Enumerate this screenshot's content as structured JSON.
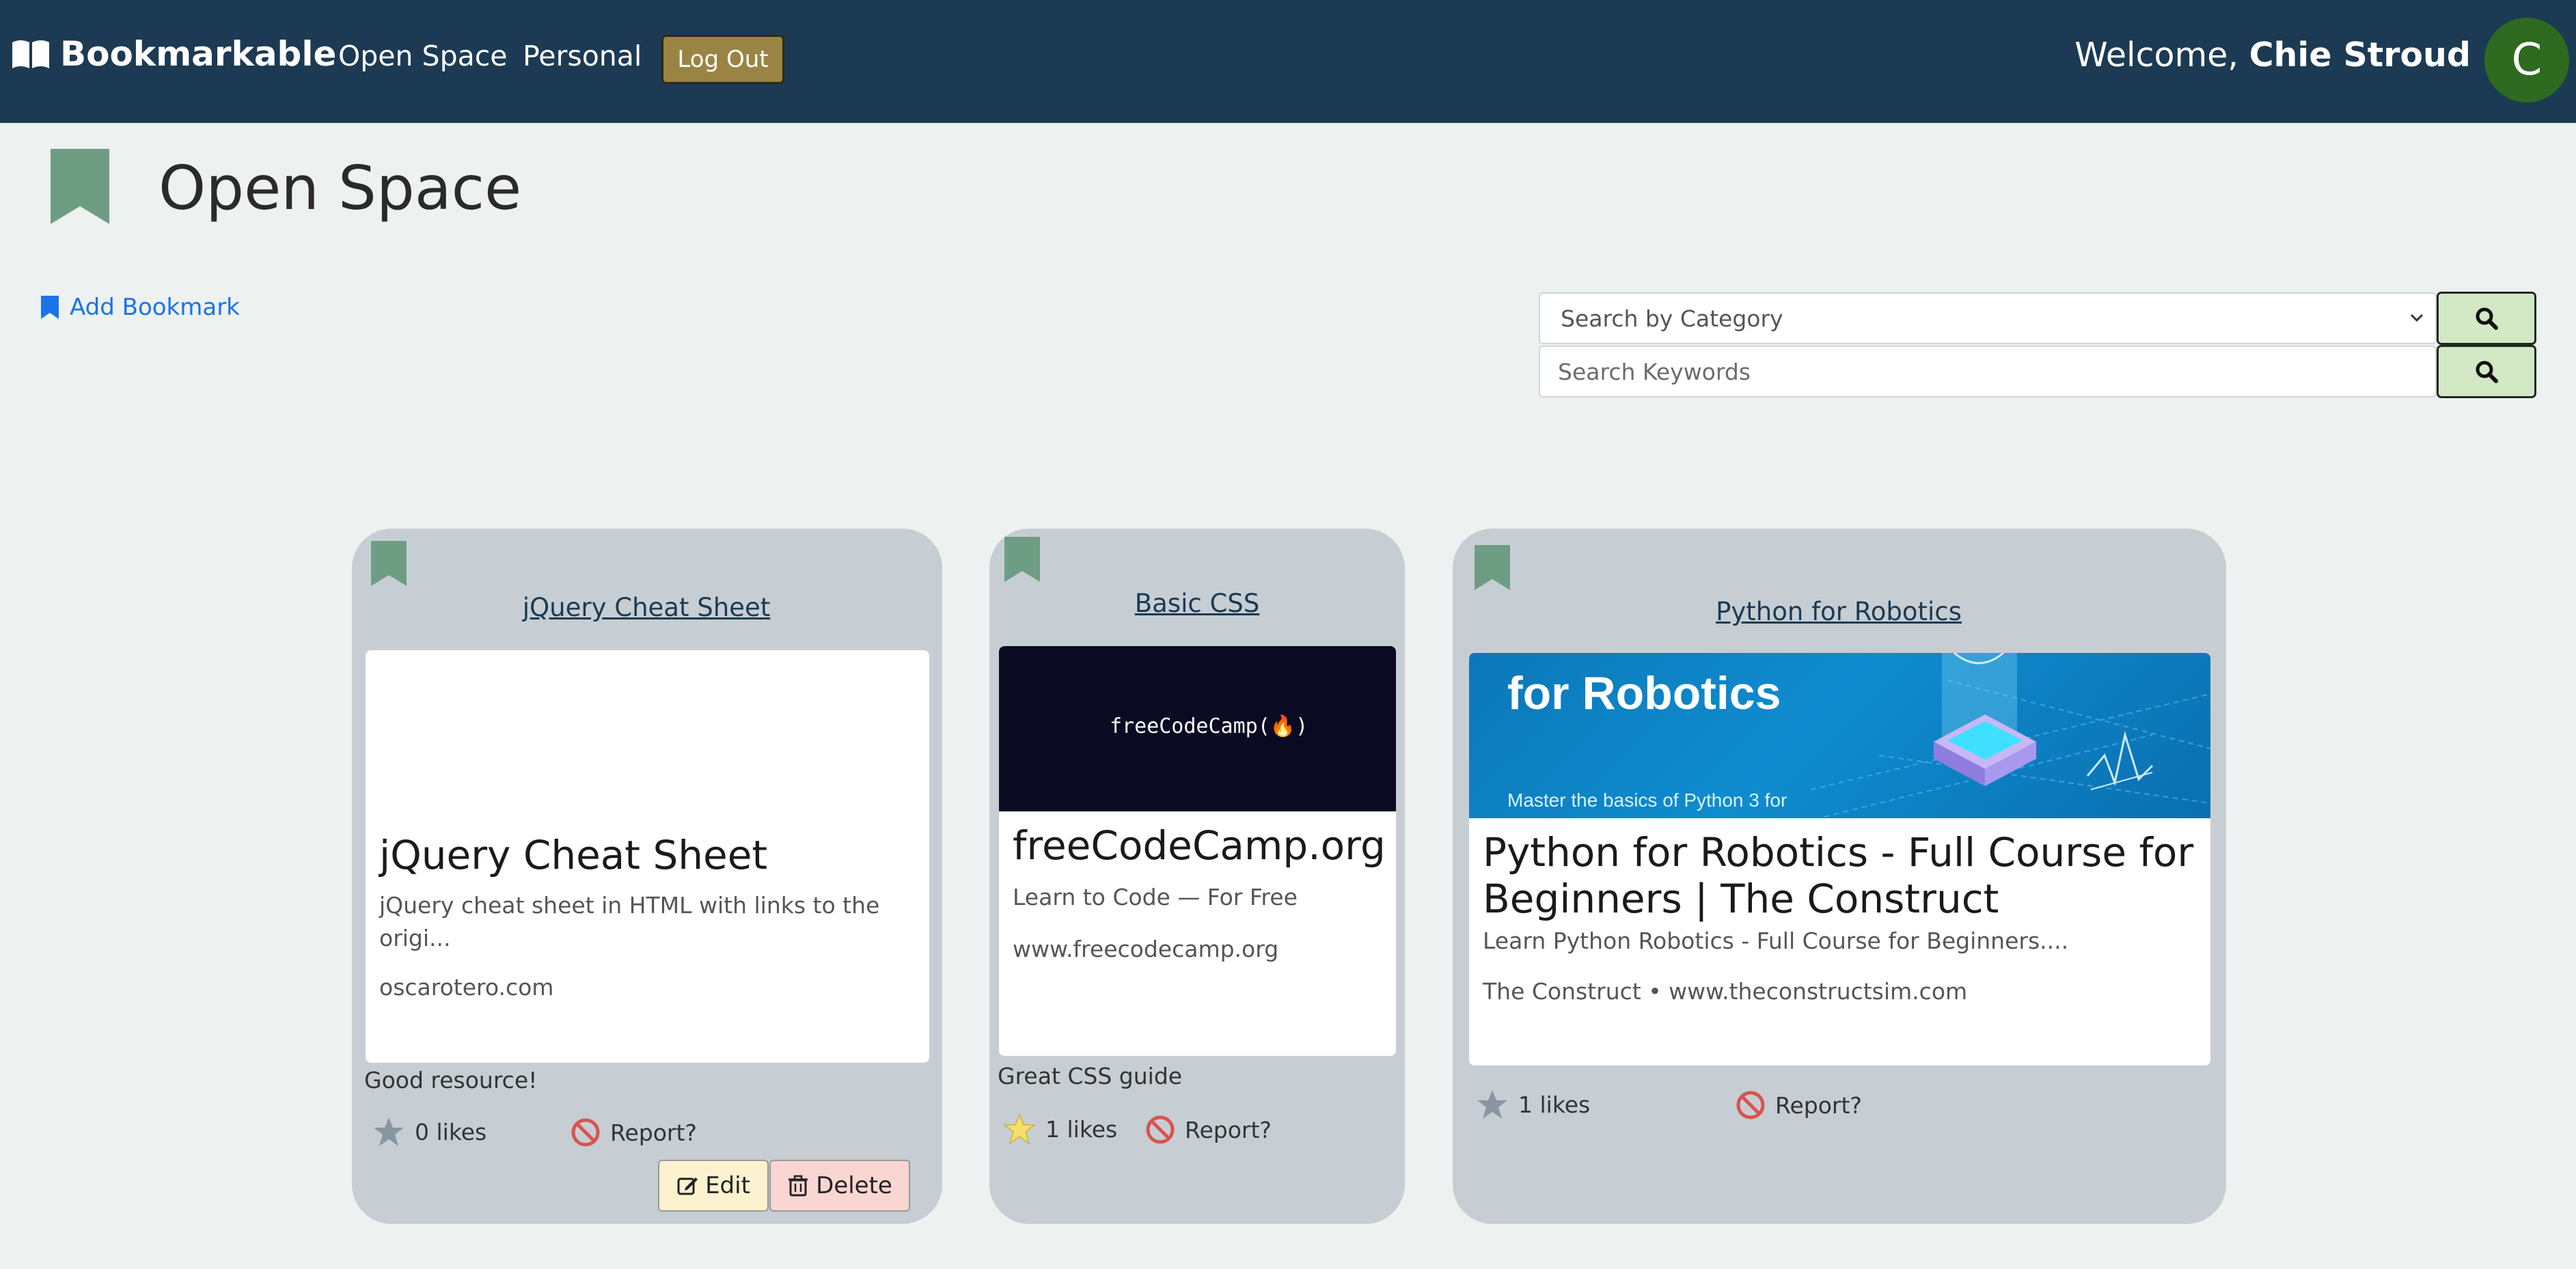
{
  "nav": {
    "brand": "Bookmarkable",
    "links": [
      "Open Space",
      "Personal"
    ],
    "logout": "Log Out",
    "welcome_prefix": "Welcome,",
    "user_name": "Chie Stroud",
    "avatar_initial": "C"
  },
  "page": {
    "title": "Open Space",
    "add_bookmark": "Add Bookmark"
  },
  "search": {
    "category_placeholder": "Search by Category",
    "keywords_placeholder": "Search Keywords"
  },
  "colors": {
    "navbar": "#1c3a53",
    "bookmark_green": "#6f9d84",
    "search_button": "#d3e8c4",
    "logout_button": "#9a8444",
    "avatar": "#2e6a1f"
  },
  "cards": [
    {
      "link_title": "jQuery Cheat Sheet",
      "preview_title": "jQuery Cheat Sheet",
      "preview_desc": "jQuery cheat sheet in HTML with links to the origi...",
      "preview_site": "oscarotero.com",
      "comment": "Good resource!",
      "likes": "0 likes",
      "report": "Report?",
      "edit": "Edit",
      "delete": "Delete"
    },
    {
      "link_title": "Basic CSS",
      "preview_image_text": "freeCodeCamp(🔥)",
      "preview_title": "freeCodeCamp.org",
      "preview_desc": "Learn to Code — For Free",
      "preview_site": "www.freecodecamp.org",
      "comment": "Great CSS guide",
      "likes": "1 likes",
      "report": "Report?"
    },
    {
      "link_title": "Python for Robotics",
      "preview_image_title": "for Robotics",
      "preview_image_sub": "Master the basics of Python 3 for",
      "preview_title": "Python for Robotics - Full Course for Beginners | The Construct",
      "preview_desc": "Learn Python Robotics - Full Course for Beginners....",
      "preview_site": "The Construct • www.theconstructsim.com",
      "likes": "1 likes",
      "report": "Report?"
    }
  ]
}
